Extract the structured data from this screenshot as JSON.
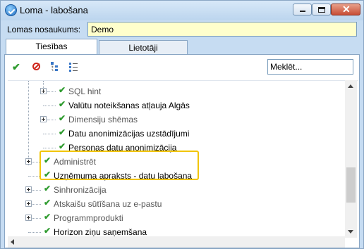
{
  "window": {
    "title": "Loma - labošana",
    "minimize_icon": "minimize-icon",
    "maximize_icon": "maximize-icon",
    "close_icon": "close-icon"
  },
  "form": {
    "name_label": "Lomas nosaukums:",
    "name_value": "Demo"
  },
  "tabs": [
    {
      "label": "Tiesības",
      "active": true
    },
    {
      "label": "Lietotāji",
      "active": false
    }
  ],
  "toolbar": {
    "icons": [
      "check-all-icon",
      "deny-icon",
      "tree-expand-icon",
      "list-view-icon"
    ],
    "search_placeholder": "Meklēt..."
  },
  "tree": {
    "items": [
      {
        "label": "SQL hint",
        "checked": true,
        "expandable": true,
        "dim": true
      },
      {
        "label": "Valūtu noteikšanas atļauja Algās",
        "checked": true,
        "expandable": false,
        "dim": false
      },
      {
        "label": "Dimensiju shēmas",
        "checked": true,
        "expandable": true,
        "dim": true
      },
      {
        "label": "Datu anonimizācijas uzstādījumi",
        "checked": true,
        "expandable": false,
        "dim": false
      },
      {
        "label": "Personas datu anonimizācija",
        "checked": true,
        "expandable": false,
        "dim": false
      },
      {
        "label": "Administrēt",
        "checked": true,
        "expandable": true,
        "dim": true
      },
      {
        "label": "Uzņēmuma apraksts - datu labošana",
        "checked": true,
        "expandable": false,
        "dim": false
      },
      {
        "label": "Sinhronizācija",
        "checked": true,
        "expandable": true,
        "dim": true
      },
      {
        "label": "Atskaišu sūtīšana uz e-pastu",
        "checked": true,
        "expandable": true,
        "dim": true
      },
      {
        "label": "Programmprodukti",
        "checked": true,
        "expandable": true,
        "dim": true
      },
      {
        "label": "Horizon ziņu saņemšana",
        "checked": true,
        "expandable": false,
        "dim": false
      }
    ]
  },
  "colors": {
    "highlight": "#f2c500",
    "check": "#2e9b2e",
    "name_input_bg": "#ffffcc"
  }
}
